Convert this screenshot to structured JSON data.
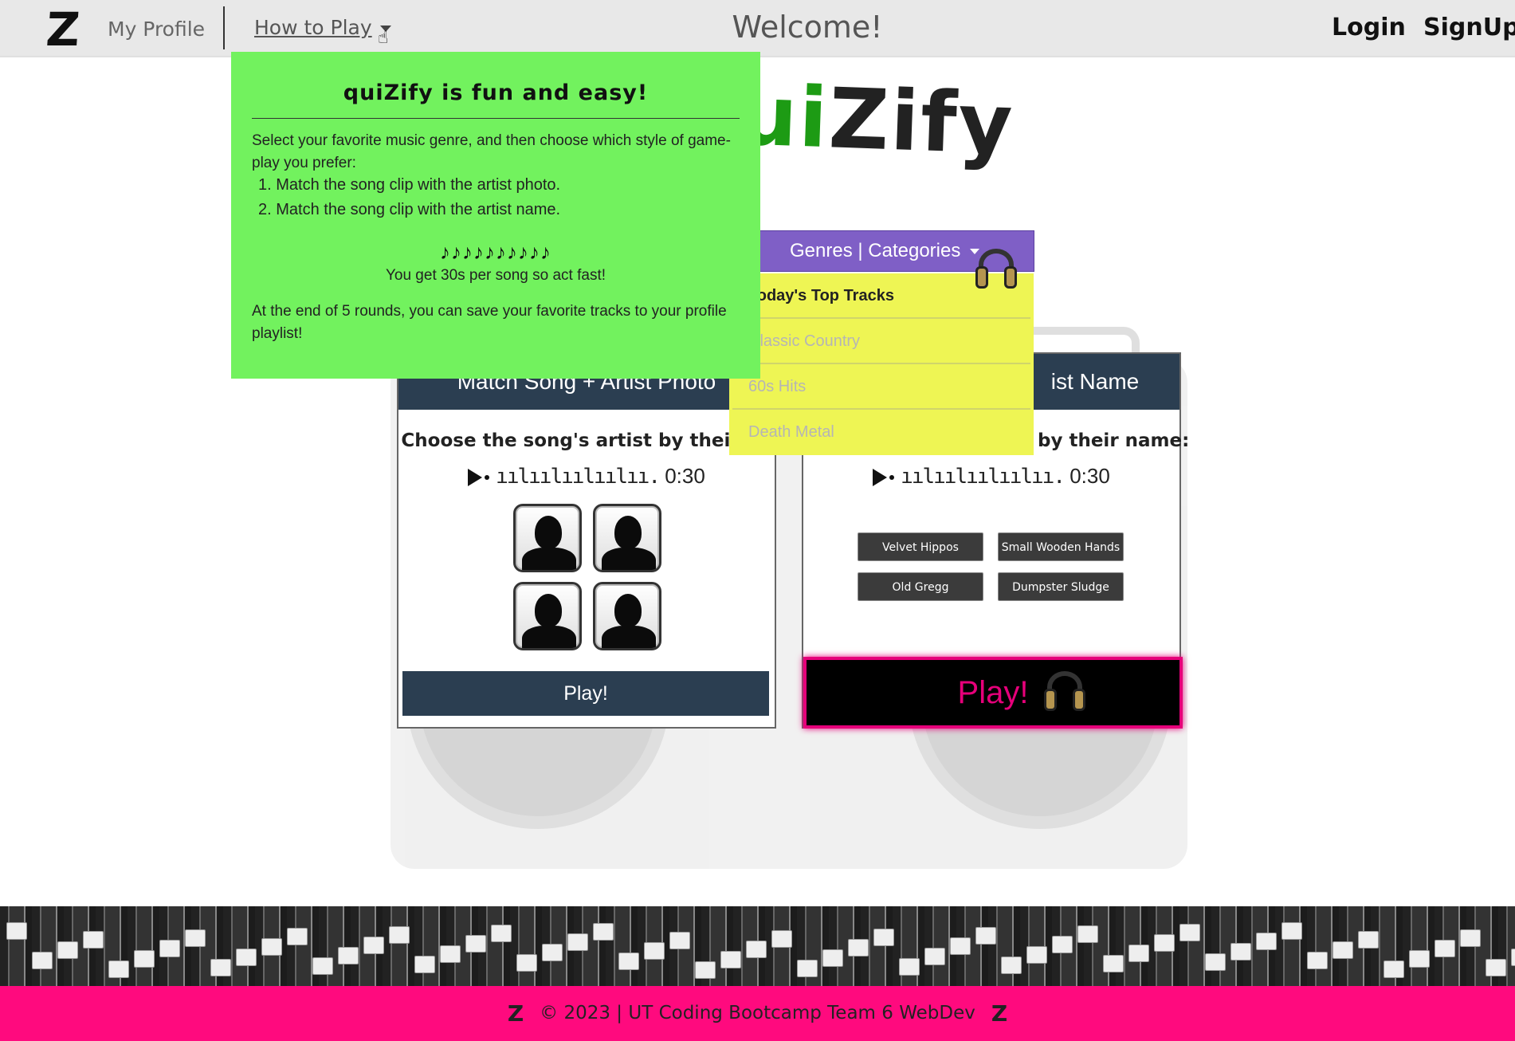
{
  "nav": {
    "logo": "Z",
    "profile": "My Profile",
    "how_to_play": "How to Play",
    "welcome": "Welcome!",
    "login": "Login",
    "signup": "SignUp"
  },
  "brand": {
    "q_part": "qui",
    "rest": "Zify"
  },
  "how_to_play_panel": {
    "title": "quiZify is fun and easy!",
    "intro": "Select your favorite music genre, and then choose which style of game-play you prefer:",
    "steps": [
      "Match the song clip with the artist photo.",
      "Match the song clip with the artist name."
    ],
    "notes": "♪♪♪♪♪♪♪♪♪♪",
    "timer_note": "You get 30s per song so act fast!",
    "outro": "At the end of 5 rounds, you can save your favorite tracks to your profile playlist!",
    "bg_color": "#72f25e"
  },
  "genres": {
    "button_label": "Genres | Categories",
    "items": [
      "Today's Top Tracks",
      "Classic Country",
      "60s Hits",
      "Death Metal"
    ],
    "active_index": 0,
    "button_color": "#7f5fc6",
    "menu_color": "#eef554"
  },
  "card_photo": {
    "header": "Match Song + Artist Photo",
    "prompt": "Choose the song's artist by their ph",
    "audio_wave": "ıılıılıılıılıı.",
    "audio_time": "0:30",
    "play_label": "Play!"
  },
  "card_name": {
    "header": "ist Name",
    "prompt": "by their name:",
    "audio_wave": "ıılıılıılıılıı.",
    "audio_time": "0:30",
    "options": [
      "Velvet Hippos",
      "Small Wooden Hands",
      "Old Gregg",
      "Dumpster Sludge"
    ],
    "play_label": "Play!"
  },
  "footer": {
    "logo": "Z",
    "text": "© 2023 | UT Coding Bootcamp Team 6 WebDev",
    "bg_color": "#ff0a7e"
  }
}
